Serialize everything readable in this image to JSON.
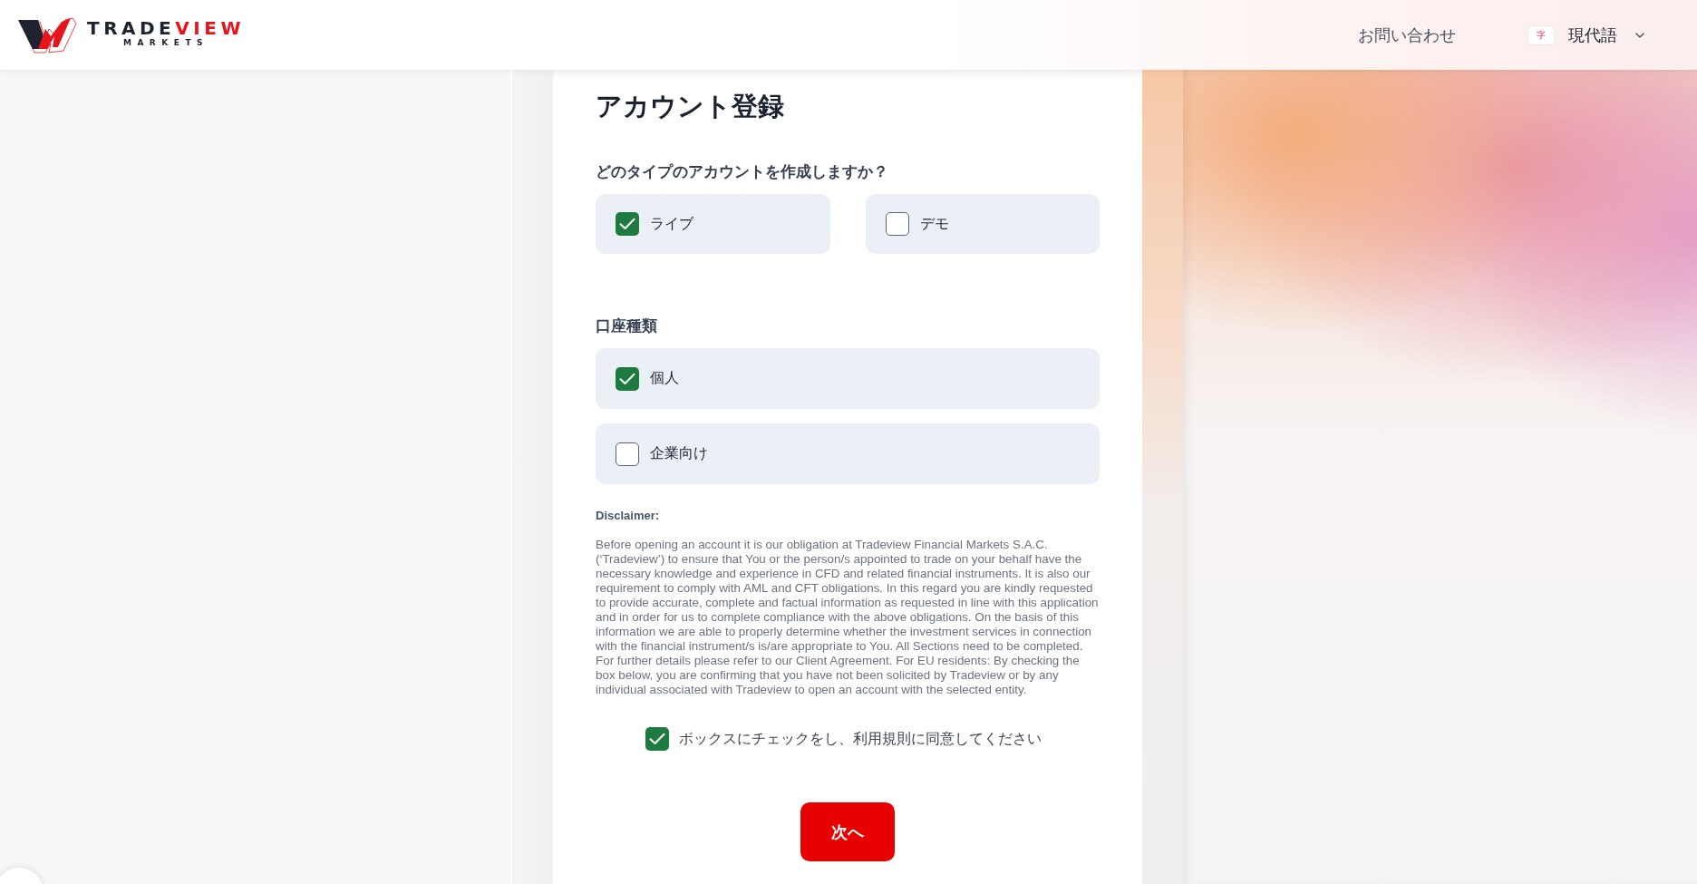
{
  "header": {
    "logo": {
      "wordmark_dark": "TRADE",
      "wordmark_accent": "VIEW",
      "tagline": "MARKETS"
    },
    "contact_link": "お問い合わせ",
    "language": {
      "badge": "字",
      "label": "現代語"
    }
  },
  "form": {
    "title": "アカウント登録",
    "account_type": {
      "question": "どのタイプのアカウントを作成しますか？",
      "options": [
        {
          "label": "ライブ",
          "selected": true
        },
        {
          "label": "デモ",
          "selected": false
        }
      ]
    },
    "holder_type": {
      "heading": "口座種類",
      "options": [
        {
          "label": "個人",
          "selected": true
        },
        {
          "label": "企業向け",
          "selected": false
        }
      ]
    },
    "disclaimer": {
      "heading": "Disclaimer:",
      "text": "Before opening an account it is our obligation at Tradeview Financial Markets S.A.C. (‘Tradeview’) to ensure that You or the person/s appointed to trade on your behalf have the necessary knowledge and experience in CFD and related financial instruments. It is also our requirement to comply with AML and CFT obligations. In this regard you are kindly requested to provide accurate, complete and factual information as requested in line with this application and in order for us to complete compliance with the above obligations. On the basis of this information we are able to properly determine whether the investment services in connection with the financial instrument/s is/are appropriate to You. All Sections need to be completed. For further details please refer to our Client Agreement. For EU residents: By checking the box below, you are confirming that you have not been solicited by Tradeview or by any individual associated with Tradeview to open an account with the selected entity."
    },
    "agreement": {
      "label": "ボックスにチェックをし、利用規則に同意してください",
      "checked": true
    },
    "next_button": "次へ"
  }
}
